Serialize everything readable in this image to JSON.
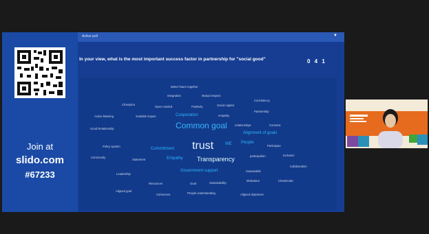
{
  "left_panel": {
    "join_line1": "Join at",
    "join_line2": "slido.com",
    "join_line3": "#67233"
  },
  "poll": {
    "tag": "Active poll",
    "question": "In your view, what is the most important success factor in partnership for \"social good\"",
    "counter": "0 4 1"
  },
  "word_cloud": [
    "Better future together",
    "Integration",
    "Mutual respect",
    "Consistency",
    "Champion",
    "Open minded",
    "Positivity",
    "Social capital",
    "Partnership",
    "Active listening",
    "Scalable impact",
    "Cooperation",
    "empathy",
    "Good Relationship",
    "relationships",
    "Common goal",
    "Consens",
    "Alignment of goals",
    "Policy system",
    "Commitment",
    "trust",
    "WE",
    "People",
    "Participate",
    "Community",
    "Statement",
    "Empathy",
    "Transparency",
    "participation",
    "Inclusion",
    "Collaboration",
    "Leadership",
    "Government support",
    "Sustainable",
    "Resources",
    "Goal",
    "Sustainability",
    "Motivation",
    "Charismatic",
    "Aligned goal",
    "Coherence",
    "People understanding",
    "Aligned objectives"
  ]
}
